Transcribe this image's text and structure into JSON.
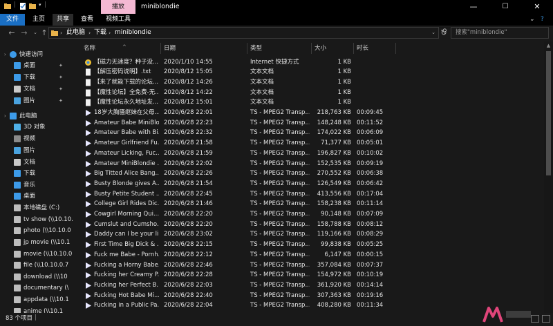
{
  "window": {
    "title": "miniblondie",
    "context_tab": "播放",
    "controls": [
      "—",
      "☐",
      "✕"
    ]
  },
  "ribbon": {
    "tabs": [
      "文件",
      "主页",
      "共享",
      "查看",
      "视频工具"
    ]
  },
  "address": {
    "crumbs": [
      "此电脑",
      "下载",
      "miniblondie"
    ],
    "search_placeholder": "搜索\"miniblondie\""
  },
  "nav": {
    "items": [
      {
        "label": "快速访问",
        "icon": "star-icon",
        "color": "#3d9be9"
      },
      {
        "label": "桌面",
        "icon": "desktop-icon",
        "color": "#3d9be9",
        "pinned": true
      },
      {
        "label": "下载",
        "icon": "download-icon",
        "color": "#3d9be9",
        "pinned": true
      },
      {
        "label": "文档",
        "icon": "document-icon",
        "color": "#c9c9c9",
        "pinned": true
      },
      {
        "label": "图片",
        "icon": "picture-icon",
        "color": "#4aa3df",
        "pinned": true
      },
      {
        "label": "此电脑",
        "icon": "computer-icon",
        "color": "#3d9be9"
      },
      {
        "label": "3D 对象",
        "icon": "cube-icon",
        "color": "#4fb0e8"
      },
      {
        "label": "视频",
        "icon": "video-icon",
        "color": "#8a8a8a"
      },
      {
        "label": "图片",
        "icon": "picture-icon",
        "color": "#4aa3df"
      },
      {
        "label": "文档",
        "icon": "document-icon",
        "color": "#c9c9c9"
      },
      {
        "label": "下载",
        "icon": "download-icon",
        "color": "#3d9be9"
      },
      {
        "label": "音乐",
        "icon": "music-icon",
        "color": "#3d9be9"
      },
      {
        "label": "桌面",
        "icon": "desktop-icon",
        "color": "#3d9be9"
      },
      {
        "label": "本地磁盘 (C:)",
        "icon": "drive-icon",
        "color": "#bdbdbd"
      },
      {
        "label": "tv show (\\\\10.10.",
        "icon": "network-drive-icon",
        "color": "#bdbdbd"
      },
      {
        "label": "photo (\\\\10.10.0",
        "icon": "network-drive-icon",
        "color": "#bdbdbd"
      },
      {
        "label": "jp movie (\\\\10.1",
        "icon": "network-drive-icon",
        "color": "#bdbdbd"
      },
      {
        "label": "movie (\\\\10.10.0",
        "icon": "network-drive-icon",
        "color": "#bdbdbd"
      },
      {
        "label": "file (\\\\10.10.0.7",
        "icon": "network-drive-icon",
        "color": "#bdbdbd"
      },
      {
        "label": "download (\\\\10",
        "icon": "network-drive-icon",
        "color": "#bdbdbd"
      },
      {
        "label": "documentary (\\",
        "icon": "network-drive-icon",
        "color": "#bdbdbd"
      },
      {
        "label": "appdata (\\\\10.1",
        "icon": "network-drive-icon",
        "color": "#bdbdbd"
      },
      {
        "label": "anime (\\\\10.1",
        "icon": "network-drive-icon",
        "color": "#bdbdbd"
      }
    ]
  },
  "columns": [
    "名称",
    "日期",
    "类型",
    "大小",
    "时长"
  ],
  "files": [
    {
      "name": "【磁力无速度？种子没...",
      "date": "2020/1/10 14:55",
      "type": "Internet 快捷方式",
      "size": "1 KB",
      "duration": "",
      "icon": "shortcut-icon"
    },
    {
      "name": "【解压密码说明】.txt",
      "date": "2020/8/12 15:05",
      "type": "文本文档",
      "size": "1 KB",
      "duration": "",
      "icon": "text-file-icon"
    },
    {
      "name": "【来了就能下载的论坛...",
      "date": "2020/8/12 14:26",
      "type": "文本文档",
      "size": "1 KB",
      "duration": "",
      "icon": "text-file-icon"
    },
    {
      "name": "【魔性论坛】全免费-无...",
      "date": "2020/8/12 14:22",
      "type": "文本文档",
      "size": "1 KB",
      "duration": "",
      "icon": "text-file-icon"
    },
    {
      "name": "【魔性论坛永久地址发...",
      "date": "2020/8/12 15:01",
      "type": "文本文档",
      "size": "1 KB",
      "duration": "",
      "icon": "text-file-icon"
    },
    {
      "name": "18岁大胸骚继妹在父母...",
      "date": "2020/6/28 22:01",
      "type": "TS - MPEG2 Transp...",
      "size": "218,763 KB",
      "duration": "00:09:45",
      "icon": "video-file-icon"
    },
    {
      "name": "Amateur Babe MiniBlo...",
      "date": "2020/6/28 22:23",
      "type": "TS - MPEG2 Transp...",
      "size": "148,248 KB",
      "duration": "00:11:52",
      "icon": "video-file-icon"
    },
    {
      "name": "Amateur Babe with Bi...",
      "date": "2020/6/28 22:32",
      "type": "TS - MPEG2 Transp...",
      "size": "174,022 KB",
      "duration": "00:06:09",
      "icon": "video-file-icon"
    },
    {
      "name": "Amateur Girlfriend Fu...",
      "date": "2020/6/28 21:58",
      "type": "TS - MPEG2 Transp...",
      "size": "71,377 KB",
      "duration": "00:05:01",
      "icon": "video-file-icon"
    },
    {
      "name": "Amateur Licking, Fuc...",
      "date": "2020/6/28 21:59",
      "type": "TS - MPEG2 Transp...",
      "size": "196,827 KB",
      "duration": "00:10:02",
      "icon": "video-file-icon"
    },
    {
      "name": "Amateur MiniBlondie ...",
      "date": "2020/6/28 22:02",
      "type": "TS - MPEG2 Transp...",
      "size": "152,535 KB",
      "duration": "00:09:19",
      "icon": "video-file-icon"
    },
    {
      "name": "Big Titted Alice Bang...",
      "date": "2020/6/28 22:26",
      "type": "TS - MPEG2 Transp...",
      "size": "270,552 KB",
      "duration": "00:06:38",
      "icon": "video-file-icon"
    },
    {
      "name": "Busty Blonde gives A...",
      "date": "2020/6/28 21:54",
      "type": "TS - MPEG2 Transp...",
      "size": "126,549 KB",
      "duration": "00:06:42",
      "icon": "video-file-icon"
    },
    {
      "name": "Busty Petite Student ...",
      "date": "2020/6/28 22:45",
      "type": "TS - MPEG2 Transp...",
      "size": "413,556 KB",
      "duration": "00:17:04",
      "icon": "video-file-icon"
    },
    {
      "name": "College Girl Rides Dic...",
      "date": "2020/6/28 21:46",
      "type": "TS - MPEG2 Transp...",
      "size": "158,238 KB",
      "duration": "00:11:14",
      "icon": "video-file-icon"
    },
    {
      "name": "Cowgirl Morning Qui...",
      "date": "2020/6/28 22:20",
      "type": "TS - MPEG2 Transp...",
      "size": "90,148 KB",
      "duration": "00:07:09",
      "icon": "video-file-icon"
    },
    {
      "name": "Cumslut and Cumsho...",
      "date": "2020/6/28 22:20",
      "type": "TS - MPEG2 Transp...",
      "size": "158,788 KB",
      "duration": "00:08:12",
      "icon": "video-file-icon"
    },
    {
      "name": "Daddy can I be your li...",
      "date": "2020/6/28 23:02",
      "type": "TS - MPEG2 Transp...",
      "size": "119,166 KB",
      "duration": "00:08:29",
      "icon": "video-file-icon"
    },
    {
      "name": "First Time Big Dick & ...",
      "date": "2020/6/28 22:15",
      "type": "TS - MPEG2 Transp...",
      "size": "99,838 KB",
      "duration": "00:05:25",
      "icon": "video-file-icon"
    },
    {
      "name": "Fuck me Babe - Pornh...",
      "date": "2020/6/28 22:12",
      "type": "TS - MPEG2 Transp...",
      "size": "6,147 KB",
      "duration": "00:00:15",
      "icon": "video-file-icon"
    },
    {
      "name": "Fucking a Horny Babe...",
      "date": "2020/6/28 22:46",
      "type": "TS - MPEG2 Transp...",
      "size": "357,084 KB",
      "duration": "00:07:37",
      "icon": "video-file-icon"
    },
    {
      "name": "Fucking her Creamy P...",
      "date": "2020/6/28 22:28",
      "type": "TS - MPEG2 Transp...",
      "size": "154,972 KB",
      "duration": "00:10:19",
      "icon": "video-file-icon"
    },
    {
      "name": "Fucking her Perfect B...",
      "date": "2020/6/28 22:03",
      "type": "TS - MPEG2 Transp...",
      "size": "361,920 KB",
      "duration": "00:14:14",
      "icon": "video-file-icon"
    },
    {
      "name": "Fucking Hot Babe Mi...",
      "date": "2020/6/28 22:40",
      "type": "TS - MPEG2 Transp...",
      "size": "307,363 KB",
      "duration": "00:19:16",
      "icon": "video-file-icon"
    },
    {
      "name": "Fucking in a Public Pa...",
      "date": "2020/6/28 22:04",
      "type": "TS - MPEG2 Transp...",
      "size": "408,280 KB",
      "duration": "00:11:34",
      "icon": "video-file-icon"
    }
  ],
  "status": {
    "count": "83 个项目"
  },
  "colors": {
    "accent": "#1a6fc4",
    "context": "#f4b8d3",
    "bg": "#191919"
  }
}
